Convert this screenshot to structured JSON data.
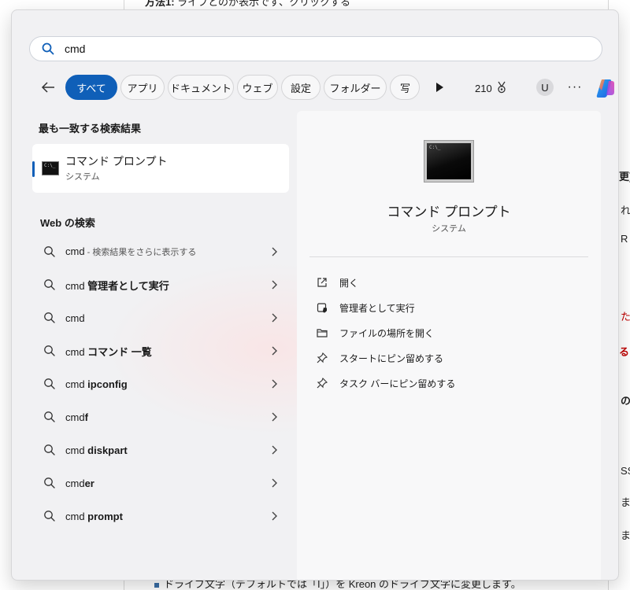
{
  "background": {
    "top_fragment": "方法1: ",
    "top_fragment2": "ライブとのが表示です、クリックする",
    "right_frags": [
      "更)",
      "れ",
      "R",
      "た",
      "る",
      "の",
      "SS",
      "ま",
      "ま"
    ],
    "bottom_text": "ドライブ文字（デフォルトでは「I」）を Kreon のドライブ文字に変更します。"
  },
  "search": {
    "value": "cmd",
    "placeholder": ""
  },
  "filters": {
    "items": [
      "すべて",
      "アプリ",
      "ドキュメント",
      "ウェブ",
      "設定",
      "フォルダー",
      "写"
    ],
    "points": "210"
  },
  "account": {
    "avatar_letter": "U"
  },
  "best_match": {
    "section_title": "最も一致する検索結果",
    "name": "コマンド プロンプト",
    "type": "システム"
  },
  "web": {
    "section_title": "Web の検索",
    "items": [
      {
        "prefix": "cmd",
        "bold": "",
        "small": " - 検索結果をさらに表示する"
      },
      {
        "prefix": "cmd ",
        "bold": "管理者として実行",
        "small": ""
      },
      {
        "prefix": "cmd",
        "bold": "",
        "small": ""
      },
      {
        "prefix": "cmd ",
        "bold": "コマンド 一覧",
        "small": ""
      },
      {
        "prefix": "cmd ",
        "bold": "ipconfig",
        "small": ""
      },
      {
        "prefix": "cmd",
        "bold": "f",
        "small": ""
      },
      {
        "prefix": "cmd ",
        "bold": "diskpart",
        "small": ""
      },
      {
        "prefix": "cmd",
        "bold": "er",
        "small": ""
      },
      {
        "prefix": "cmd ",
        "bold": "prompt",
        "small": ""
      }
    ]
  },
  "detail": {
    "title": "コマンド プロンプト",
    "subtitle": "システム",
    "actions": [
      {
        "icon": "open-icon",
        "label": "開く"
      },
      {
        "icon": "admin-shield-icon",
        "label": "管理者として実行"
      },
      {
        "icon": "folder-icon",
        "label": "ファイルの場所を開く"
      },
      {
        "icon": "pin-icon",
        "label": "スタートにピン留めする"
      },
      {
        "icon": "pin-icon",
        "label": "タスク バーにピン留めする"
      }
    ]
  },
  "colors": {
    "accent": "#0f5fb8",
    "panel_bg": "#f1f1f3",
    "card_bg": "#ffffff"
  }
}
